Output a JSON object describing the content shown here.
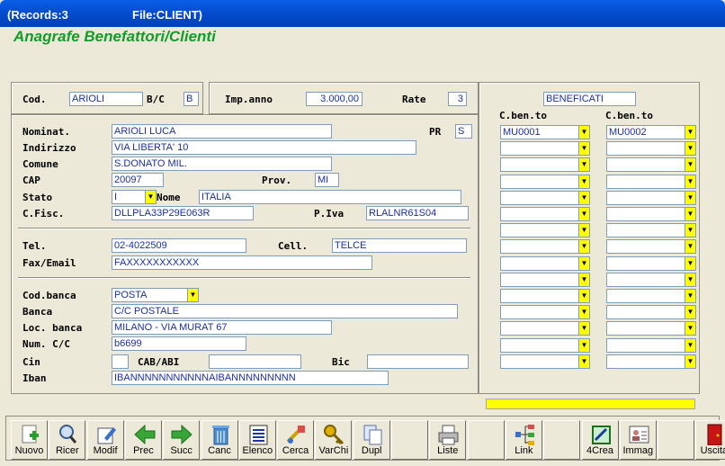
{
  "window": {
    "records": "(Records:3",
    "file": "File:CLIENT)"
  },
  "app_title": "Anagrafe Benefattori/Clienti",
  "top": {
    "cod_label": "Cod.",
    "cod_value": "ARIOLI",
    "bc_label": "B/C",
    "bc_value": "B",
    "imp_label": "Imp.anno",
    "imp_value": "3.000,00",
    "rate_label": "Rate",
    "rate_value": "3"
  },
  "anag": {
    "nominat_label": "Nominat.",
    "nominat_value": "ARIOLI LUCA",
    "pr_label": "PR",
    "pr_value": "S",
    "indirizzo_label": "Indirizzo",
    "indirizzo_value": "VIA LIBERTA' 10",
    "comune_label": "Comune",
    "comune_value": "S.DONATO MIL.",
    "cap_label": "CAP",
    "cap_value": "20097",
    "prov_label": "Prov.",
    "prov_value": "MI",
    "stato_label": "Stato",
    "stato_value": "I",
    "nome_label": "Nome",
    "nome_value": "ITALIA",
    "cfisc_label": "C.Fisc.",
    "cfisc_value": "DLLPLA33P29E063R",
    "piva_label": "P.Iva",
    "piva_value": "RLALNR61S04"
  },
  "contatti": {
    "tel_label": "Tel.",
    "tel_value": "02-4022509",
    "cell_label": "Cell.",
    "cell_value": "TELCE",
    "fax_label": "Fax/Email",
    "fax_value": "FAXXXXXXXXXXX"
  },
  "banca": {
    "codbanca_label": "Cod.banca",
    "codbanca_value": "POSTA",
    "banca_label": "Banca",
    "banca_value": "C/C POSTALE",
    "loc_label": "Loc. banca",
    "loc_value": "MILANO - VIA MURAT 67",
    "numcc_label": "Num. C/C",
    "numcc_value": "b6699",
    "cin_label": "Cin",
    "cin_value": "",
    "cababi_label": "CAB/ABI",
    "cababi_value": "",
    "bic_label": "Bic",
    "bic_value": "",
    "iban_label": "Iban",
    "iban_value": "IBANNNNNNNNNNNAIBANNNNNNNNN"
  },
  "beneficati": {
    "title": "BENEFICATI",
    "col1_label": "C.ben.to",
    "col2_label": "C.ben.to",
    "col1": [
      "MU0001",
      "",
      "",
      "",
      "",
      "",
      "",
      "",
      "",
      "",
      "",
      "",
      "",
      "",
      ""
    ],
    "col2": [
      "MU0002",
      "",
      "",
      "",
      "",
      "",
      "",
      "",
      "",
      "",
      "",
      "",
      "",
      "",
      ""
    ]
  },
  "toolbar": [
    {
      "label": "Nuovo",
      "icon": "new-icon"
    },
    {
      "label": "Ricer",
      "icon": "search-icon"
    },
    {
      "label": "Modif",
      "icon": "edit-icon"
    },
    {
      "label": "Prec",
      "icon": "arrow-left-icon"
    },
    {
      "label": "Succ",
      "icon": "arrow-right-icon"
    },
    {
      "label": "Canc",
      "icon": "trash-icon"
    },
    {
      "label": "Elenco",
      "icon": "list-icon"
    },
    {
      "label": "Cerca",
      "icon": "find-icon"
    },
    {
      "label": "VarChi",
      "icon": "key-icon"
    },
    {
      "label": "Dupl",
      "icon": "duplicate-icon"
    },
    {
      "label": "",
      "icon": ""
    },
    {
      "label": "Liste",
      "icon": "printer-icon"
    },
    {
      "label": "",
      "icon": ""
    },
    {
      "label": "Link",
      "icon": "link-tree-icon"
    },
    {
      "label": "",
      "icon": ""
    },
    {
      "label": "4Crea",
      "icon": "create-icon"
    },
    {
      "label": "Immag",
      "icon": "image-card-icon"
    },
    {
      "label": "",
      "icon": ""
    },
    {
      "label": "Uscita",
      "icon": "exit-door-icon"
    }
  ]
}
